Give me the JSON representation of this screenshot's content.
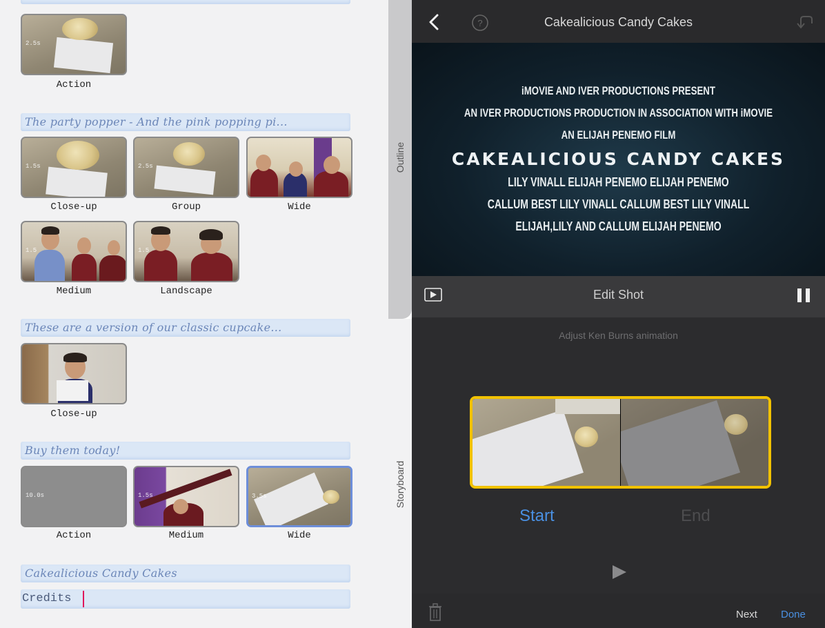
{
  "storyboard": {
    "sections": [
      {
        "title": "",
        "shots": [
          {
            "caption": "Action",
            "duration": "2.5s"
          }
        ]
      },
      {
        "title": "The party popper - And the pink popping pi...",
        "shots": [
          {
            "caption": "Close-up",
            "duration": "1.5s"
          },
          {
            "caption": "Group",
            "duration": "2.5s"
          },
          {
            "caption": "Wide",
            "duration": ""
          },
          {
            "caption": "Medium",
            "duration": "1.5"
          },
          {
            "caption": "Landscape",
            "duration": "1.5"
          }
        ]
      },
      {
        "title": "These are a version of our classic cupcake...",
        "shots": [
          {
            "caption": "Close-up",
            "duration": ""
          }
        ]
      },
      {
        "title": "Buy them today!",
        "shots": [
          {
            "caption": "Action",
            "duration": "10.0s"
          },
          {
            "caption": "Medium",
            "duration": "1.5s"
          },
          {
            "caption": "Wide",
            "duration": "3.5s"
          }
        ]
      }
    ],
    "closing_title": "Cakealicious Candy Cakes",
    "credits_field": "Credits"
  },
  "side_tabs": {
    "outline": "Outline",
    "storyboard": "Storyboard"
  },
  "editor": {
    "title": "Cakealicious Candy Cakes",
    "credits": {
      "line1": "iMOVIE AND IVER PRODUCTIONS PRESENT",
      "line2": "AN IVER PRODUCTIONS PRODUCTION IN ASSOCIATION WITH iMOVIE",
      "line3": "AN ELIJAH PENEMO FILM",
      "title": "CAKEALICIOUS CANDY CAKES",
      "line5": "LILY VINALL  ELIJAH PENEMO  ELIJAH PENEMO",
      "line6": "CALLUM BEST  LILY VINALL  CALLUM BEST  LILY VINALL",
      "line7": "ELIJAH,LILY AND CALLUM  ELIJAH PENEMO"
    },
    "edit_label": "Edit Shot",
    "adjust_label": "Adjust Ken Burns animation",
    "start_label": "Start",
    "end_label": "End",
    "next_label": "Next",
    "done_label": "Done"
  },
  "colors": {
    "accent_blue": "#4a90e2",
    "selection_yellow": "#f2c200"
  }
}
